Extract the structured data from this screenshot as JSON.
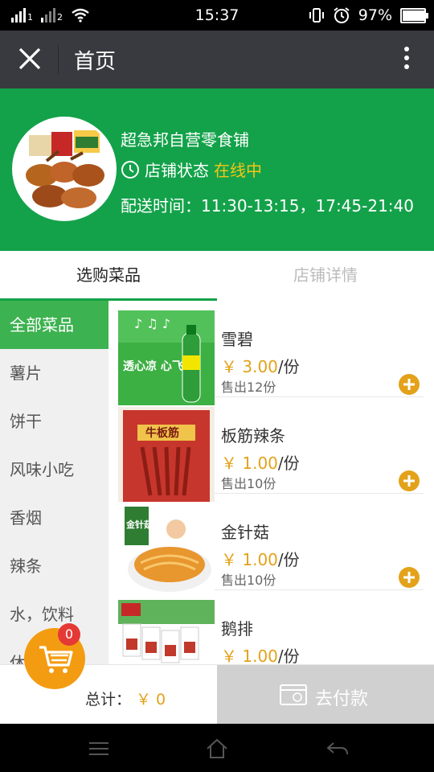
{
  "status_bar": {
    "time": "15:37",
    "battery": "97%",
    "battery_level": 0.97,
    "sim1": "1",
    "sim2": "2"
  },
  "app_bar": {
    "title": "首页"
  },
  "shop": {
    "name": "超急邦自营零食铺",
    "status_label": "店铺状态",
    "status_value": "在线中",
    "delivery": "配送时间：11:30-13:15，17:45-21:40"
  },
  "tabs": [
    {
      "label": "选购菜品"
    },
    {
      "label": "店铺详情"
    }
  ],
  "categories": [
    {
      "label": "全部菜品"
    },
    {
      "label": "薯片"
    },
    {
      "label": "饼干"
    },
    {
      "label": "风味小吃"
    },
    {
      "label": "香烟"
    },
    {
      "label": "辣条"
    },
    {
      "label": "水，饮料"
    },
    {
      "label": "休"
    }
  ],
  "products": [
    {
      "name": "雪碧",
      "price": "￥ 3.00",
      "unit": "/份",
      "sold": "售出12份",
      "thumb_text": "透心凉 心飞扬"
    },
    {
      "name": "板筋辣条",
      "price": "￥ 1.00",
      "unit": "/份",
      "sold": "售出10份",
      "thumb_text": "牛板筋"
    },
    {
      "name": "金针菇",
      "price": "￥ 1.00",
      "unit": "/份",
      "sold": "售出10份",
      "thumb_text": "金针菇"
    },
    {
      "name": "鹅排",
      "price": "￥ 1.00",
      "unit": "/份",
      "sold": "",
      "thumb_text": ""
    }
  ],
  "cart": {
    "count": "0",
    "total_label": "总计：",
    "total_amount": "￥ 0",
    "pay_label": "去付款"
  },
  "colors": {
    "green": "#13a24a",
    "accent": "#e3a21a",
    "active_cat": "#3db250",
    "fab": "#f39c12",
    "badge": "#e53935",
    "appbar": "#393a3f"
  }
}
